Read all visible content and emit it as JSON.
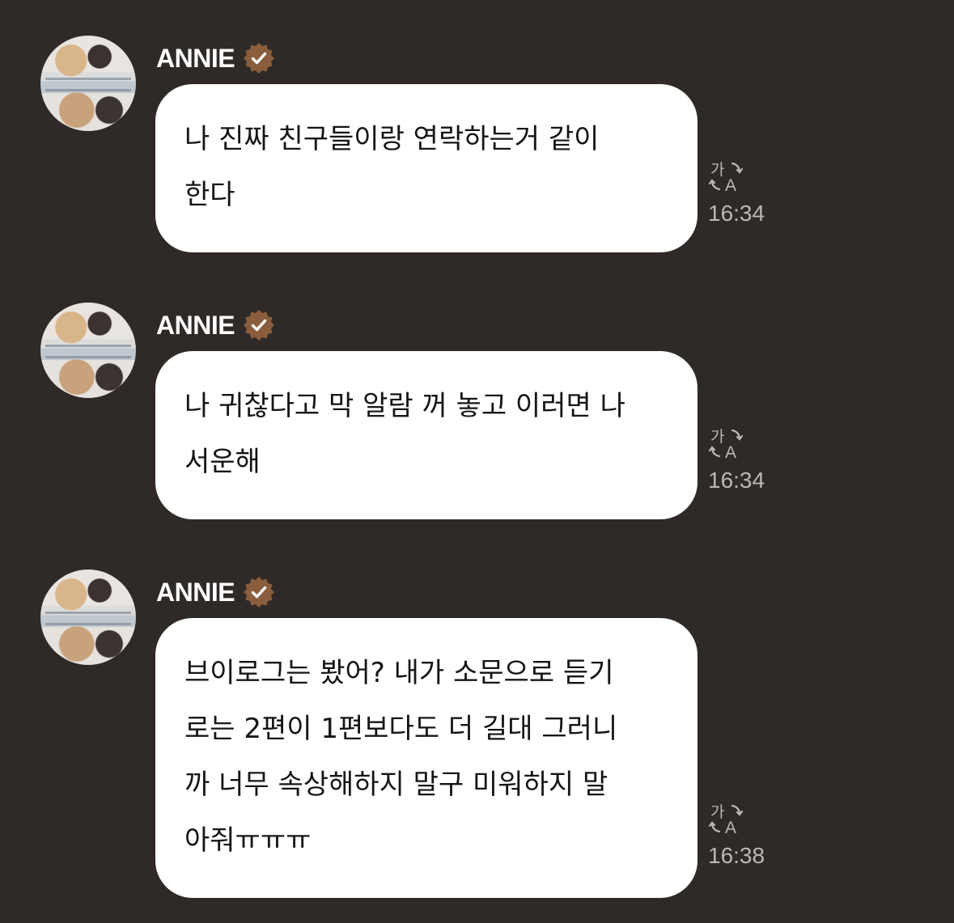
{
  "messages": [
    {
      "sender": "ANNIE",
      "text": "나 진짜 친구들이랑 연락하는거 같이\n한다",
      "time": "16:34",
      "translate_icon": "translate-icon",
      "verified_icon": "verified-badge-icon"
    },
    {
      "sender": "ANNIE",
      "text": "나 귀찮다고 막 알람 꺼 놓고 이러면 나\n서운해",
      "time": "16:34",
      "translate_icon": "translate-icon",
      "verified_icon": "verified-badge-icon"
    },
    {
      "sender": "ANNIE",
      "text": "브이로그는 봤어? 내가 소문으로 듣기\n로는 2편이 1편보다도 더 길대 그러니\n까 너무 속상해하지 말구 미워하지 말\n아줘ㅠㅠㅠ",
      "time": "16:38",
      "translate_icon": "translate-icon",
      "verified_icon": "verified-badge-icon"
    }
  ],
  "colors": {
    "background": "#2f2a27",
    "bubble": "#ffffff",
    "text": "#171513",
    "timestamp": "#bdb7b2",
    "verified_badge": "#8a5e3c"
  }
}
